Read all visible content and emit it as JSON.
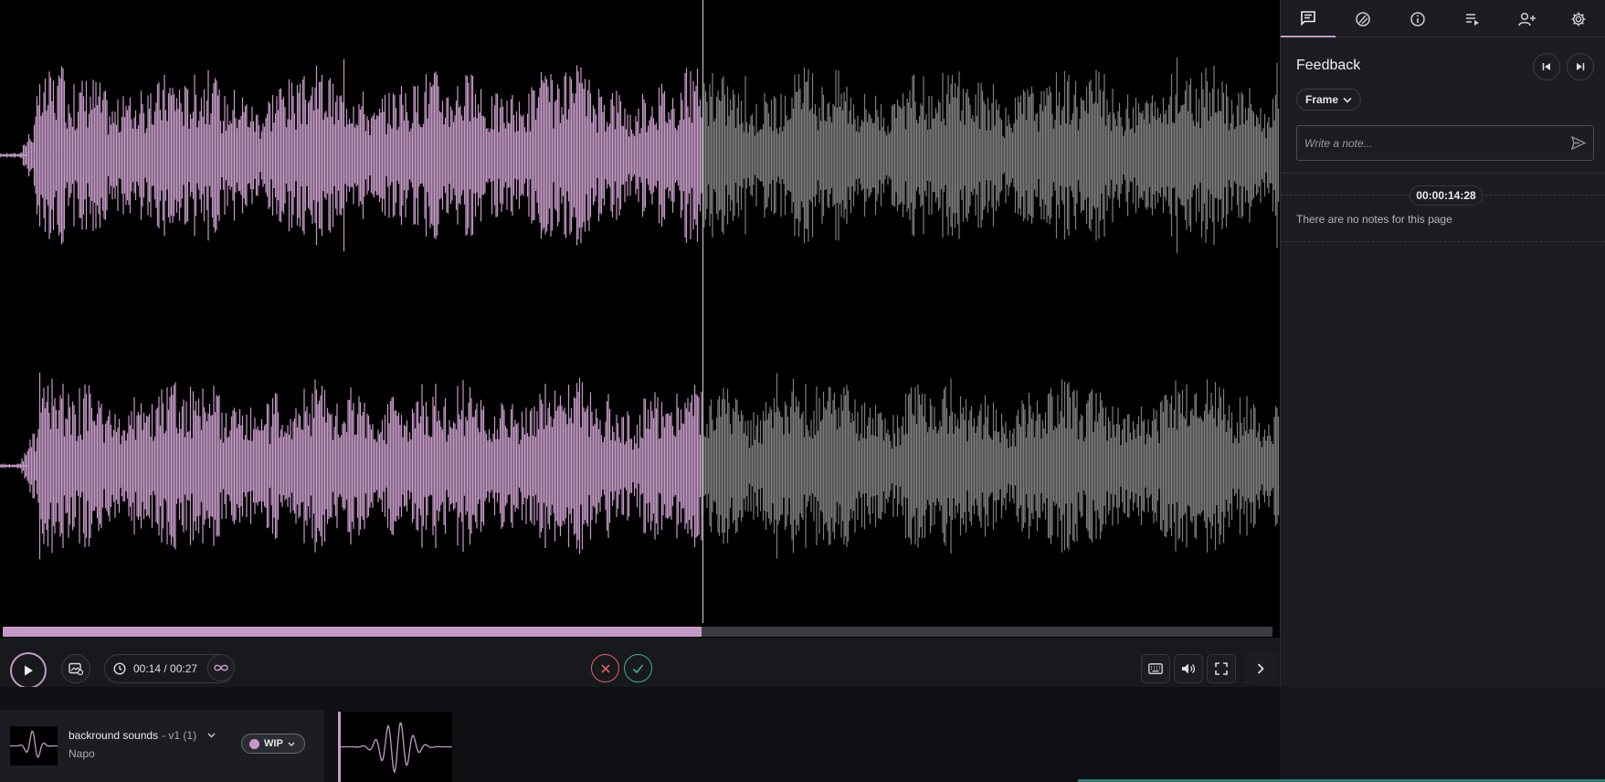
{
  "colors": {
    "accent": "#c49ac6",
    "played_wave": "#c49ac6",
    "unplayed_wave": "#7d7d7d",
    "reject": "#e0606a",
    "approve": "#3fae97"
  },
  "player": {
    "played_fraction": 0.55,
    "current_time": "00:14",
    "duration": "00:27",
    "time_separator": " / "
  },
  "sidebar": {
    "tabs": [
      {
        "icon": "comment-icon",
        "active": true
      },
      {
        "icon": "palette-icon",
        "active": false
      },
      {
        "icon": "info-icon",
        "active": false
      },
      {
        "icon": "playlist-icon",
        "active": false
      },
      {
        "icon": "add-user-icon",
        "active": false
      },
      {
        "icon": "gear-icon",
        "active": false
      }
    ],
    "title": "Feedback",
    "filter_label": "Frame",
    "note_placeholder": "Write a note...",
    "timecode": "00:00:14:28",
    "empty_message": "There are no notes for this page"
  },
  "asset": {
    "name": "backround sounds",
    "version": "- v1 (1)",
    "owner": "Napo",
    "status": "WIP"
  }
}
